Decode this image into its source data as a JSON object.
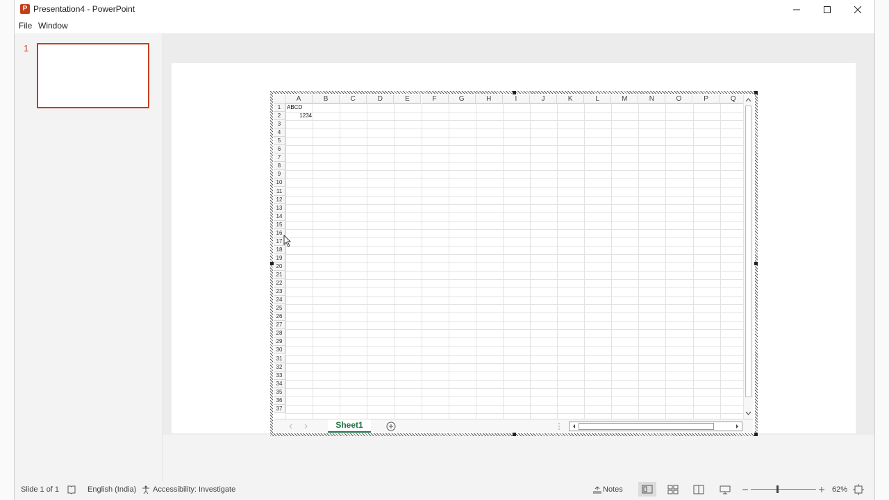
{
  "window": {
    "title": "Presentation4 - PowerPoint",
    "app_logo": "P"
  },
  "menu": {
    "file": "File",
    "window": "Window"
  },
  "thumbnails": {
    "slide_number": "1"
  },
  "workbook": {
    "columns": [
      "A",
      "B",
      "C",
      "D",
      "E",
      "F",
      "G",
      "H",
      "I",
      "J",
      "K",
      "L",
      "M",
      "N",
      "O",
      "P",
      "Q"
    ],
    "rows": [
      "1",
      "2",
      "3",
      "4",
      "5",
      "6",
      "7",
      "8",
      "9",
      "10",
      "11",
      "12",
      "13",
      "14",
      "15",
      "16",
      "17",
      "18",
      "19",
      "20",
      "21",
      "22",
      "23",
      "24",
      "25",
      "26",
      "27",
      "28",
      "29",
      "30",
      "31",
      "32",
      "33",
      "34",
      "35",
      "36",
      "37"
    ],
    "cells": {
      "A1": "ABCD",
      "A2": "1234"
    },
    "sheet_tab": "Sheet1",
    "add_sheet_icon": "plus-circle-icon"
  },
  "statusbar": {
    "slide_info": "Slide 1 of 1",
    "language": "English (India)",
    "accessibility": "Accessibility: Investigate",
    "notes": "Notes",
    "zoom": "62%"
  }
}
